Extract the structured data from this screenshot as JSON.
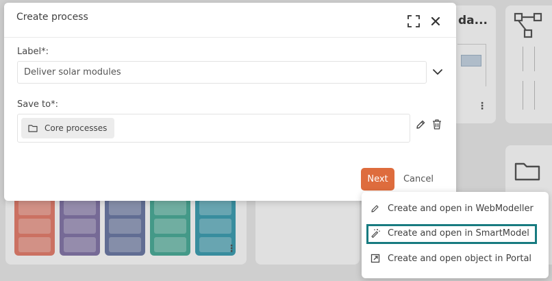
{
  "dialog": {
    "title": "Create process",
    "label_field": {
      "label": "Label*:",
      "value": "Deliver solar modules"
    },
    "save_field": {
      "label": "Save to*:",
      "folder": "Core processes"
    },
    "next_label": "Next",
    "cancel_label": "Cancel"
  },
  "menu": {
    "items": [
      {
        "label": "Create and open in WebModeller",
        "icon": "pencil-icon",
        "active": false
      },
      {
        "label": "Create and open in SmartModel",
        "icon": "magic-wand-icon",
        "active": true
      },
      {
        "label": "Create and open object in Portal",
        "icon": "open-external-icon",
        "active": false
      }
    ]
  },
  "background": {
    "card_title_fragment": "da...",
    "lane_colors": [
      "#e27e6e",
      "#8476a8",
      "#6d7aa4",
      "#4cab98",
      "#3f9db0"
    ]
  },
  "colors": {
    "accent": "#de6c3d",
    "focus_outline": "#177b80"
  }
}
